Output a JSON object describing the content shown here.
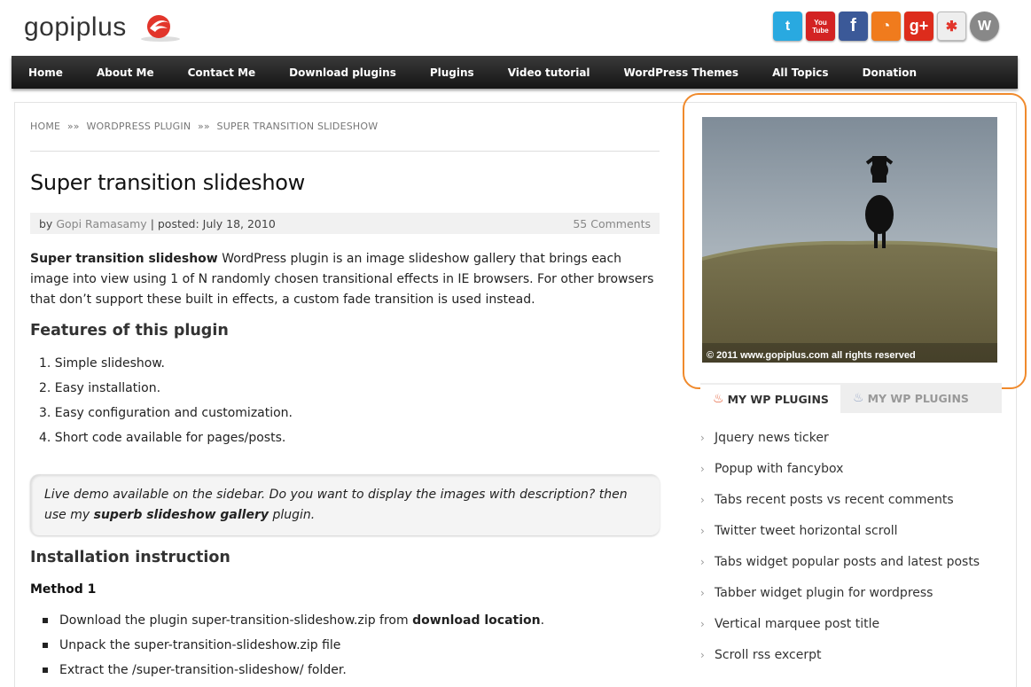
{
  "header": {
    "logo_text": "gopiplus",
    "social": [
      {
        "name": "twitter-icon",
        "glyph": "t",
        "color": "#29a9e0"
      },
      {
        "name": "youtube-icon",
        "glyph": "You Tube",
        "color": "#d32323"
      },
      {
        "name": "facebook-icon",
        "glyph": "f",
        "color": "#3b5998"
      },
      {
        "name": "rss-icon",
        "glyph": "◔",
        "color": "#f07b1d"
      },
      {
        "name": "google-plus-icon",
        "glyph": "g+",
        "color": "#dd2c1c"
      },
      {
        "name": "joomla-icon",
        "glyph": "✱",
        "color": "#888888"
      },
      {
        "name": "wordpress-icon",
        "glyph": "W",
        "color": "#777777"
      }
    ]
  },
  "nav": {
    "items": [
      "Home",
      "About Me",
      "Contact Me",
      "Download plugins",
      "Plugins",
      "Video tutorial",
      "WordPress Themes",
      "All Topics",
      "Donation"
    ]
  },
  "breadcrumb": {
    "home": "HOME",
    "sep": "»»",
    "section": "WORDPRESS PLUGIN",
    "current": "SUPER TRANSITION SLIDESHOW"
  },
  "post": {
    "title": "Super transition slideshow",
    "by": "by",
    "author": "Gopi Ramasamy",
    "posted": "| posted: July 18, 2010",
    "comments": "55 Comments",
    "intro_bold": "Super transition slideshow",
    "intro_text": " WordPress plugin is an image slideshow gallery that brings each image into view using 1 of N randomly chosen transitional effects in IE browsers. For other browsers that don’t support these built in effects, a custom fade transition is used instead.",
    "features_heading": "Features of this plugin",
    "features": [
      "1.  Simple slideshow.",
      "2.  Easy installation.",
      "3.  Easy configuration and customization.",
      "4.  Short code available for pages/posts."
    ],
    "note_text": "Live demo available on the sidebar. Do you want to display the images with description? then use my ",
    "note_bold": "superb slideshow gallery",
    "note_end": " plugin.",
    "install_heading": "Installation instruction",
    "method": "Method 1",
    "steps": [
      {
        "text": "Download the plugin super-transition-slideshow.zip from ",
        "bold": "download location",
        "end": "."
      },
      {
        "text": "Unpack the super-transition-slideshow.zip file",
        "bold": "",
        "end": ""
      },
      {
        "text": "Extract the /super-transition-slideshow/ folder.",
        "bold": "",
        "end": ""
      }
    ]
  },
  "sidebar": {
    "photo_caption": "© 2011 www.gopiplus.com all rights reserved",
    "tab1": "MY WP PLUGINS",
    "tab2": "MY WP PLUGINS",
    "plugins": [
      "Jquery news ticker",
      "Popup with fancybox",
      "Tabs recent posts vs recent comments",
      "Twitter tweet horizontal scroll",
      "Tabs widget popular posts and latest posts",
      "Tabber widget plugin for wordpress",
      "Vertical marquee post title",
      "Scroll rss excerpt"
    ]
  }
}
